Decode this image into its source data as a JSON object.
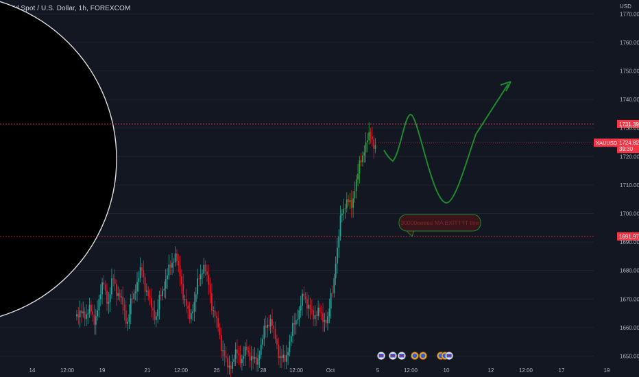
{
  "header": {
    "title": "Gold Spot / U.S. Dollar, 1h, FOREXCOM",
    "currency": "USD"
  },
  "price_scale": {
    "ticks": [
      1650,
      1660,
      1670,
      1680,
      1690,
      1700,
      1710,
      1720,
      1730,
      1740,
      1750,
      1760,
      1770
    ],
    "tick_labels": [
      "1650.00",
      "1660.00",
      "1670.00",
      "1680.00",
      "1690.00",
      "1700.00",
      "1710.00",
      "1720.00",
      "1730.00",
      "1740.00",
      "1750.00",
      "1760.00",
      "1770.00"
    ]
  },
  "time_scale": {
    "labels": [
      "14",
      "12:00",
      "19",
      "21",
      "12:00",
      "26",
      "28",
      "12:00",
      "Oct",
      "5",
      "12:00",
      "10",
      "12",
      "12:00",
      "17",
      "19"
    ]
  },
  "price_levels": [
    {
      "label": "1731.39",
      "value": 1731.39
    },
    {
      "label": "1691.97",
      "value": 1691.97
    }
  ],
  "current_price": {
    "symbol": "XAUUSD",
    "price": "1724.82",
    "countdown": "39:30",
    "value": 1724.82
  },
  "annotation": {
    "text": "30000eeeee MA EXITTTT line"
  },
  "projection": {
    "path": [
      [
        1724,
        1717
      ],
      [
        1734.5,
        1702
      ],
      [
        1748
      ]
    ]
  },
  "colors": {
    "background": "#131722",
    "bull": "#26a69a",
    "bull_bright": "#22ab3c",
    "bear": "#e8182a",
    "level_line": "#f23645",
    "projection": "#1f8a2e",
    "grid": "#1f2330",
    "axis_text": "#b2b5be"
  },
  "event_icons": [
    "flag-icon",
    "flag-icon",
    "flag-icon",
    "coin-icon",
    "coin-icon",
    "coin-icon",
    "coin-icon",
    "flag-icon"
  ],
  "chart_data": {
    "type": "candlestick",
    "title": "Gold Spot / U.S. Dollar, 1h, FOREXCOM",
    "ylabel": "USD",
    "ylim": [
      1647,
      1774
    ],
    "y_ticks": [
      1650,
      1660,
      1670,
      1680,
      1690,
      1700,
      1710,
      1720,
      1730,
      1740,
      1750,
      1760,
      1770
    ],
    "x_tick_labels": [
      "14",
      "12:00",
      "19",
      "21",
      "12:00",
      "26",
      "28",
      "12:00",
      "Oct",
      "5",
      "12:00",
      "10",
      "12",
      "12:00",
      "17",
      "19"
    ],
    "series": [
      {
        "name": "XAUUSD",
        "close_path": [
          [
            1666,
            1663,
            1668,
            1661,
            1670,
            1675,
            1669,
            1677,
            1672,
            1668,
            1662,
            1670,
            1676,
            1680,
            1673,
            1667,
            1664,
            1671,
            1677,
            1681,
            1686,
            1678,
            1670,
            1663,
            1669,
            1677,
            1682,
            1675,
            1666,
            1660,
            1652,
            1646,
            1648,
            1651,
            1649,
            1652,
            1650,
            1647,
            1654,
            1660,
            1663,
            1656,
            1650,
            1648,
            1655,
            1661,
            1666,
            1671,
            1668,
            1663,
            1667,
            1662,
            1664,
            1672,
            1688,
            1700,
            1705,
            1702,
            1712,
            1718,
            1725,
            1727,
            1724
          ]
        ]
      }
    ]
  }
}
